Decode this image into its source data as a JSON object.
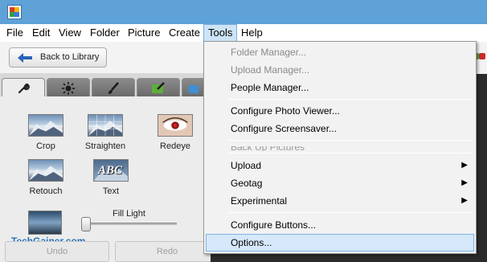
{
  "menubar": {
    "items": [
      "File",
      "Edit",
      "View",
      "Folder",
      "Picture",
      "Create",
      "Tools",
      "Help"
    ],
    "active": "Tools"
  },
  "toolbar": {
    "back_label": "Back to Library"
  },
  "edit_panel": {
    "tabs": [
      "wrench-icon",
      "brightness-icon",
      "brush-icon",
      "green-brush-icon",
      "blue-brush-icon"
    ],
    "tools": [
      {
        "label": "Crop"
      },
      {
        "label": "Straighten"
      },
      {
        "label": "Redeye"
      },
      {
        "label": "Retouch"
      },
      {
        "label": "Text",
        "thumb_text": "ABC"
      }
    ],
    "slider_label": "Fill Light",
    "undo_label": "Undo",
    "redo_label": "Redo"
  },
  "watermark": "TechGainer.com",
  "tools_menu": {
    "items": [
      {
        "label": "Folder Manager...",
        "disabled": true
      },
      {
        "label": "Upload Manager...",
        "disabled": true
      },
      {
        "label": "People Manager...",
        "disabled": false
      },
      {
        "label": "Configure Photo Viewer...",
        "disabled": false
      },
      {
        "label": "Configure Screensaver...",
        "disabled": false
      },
      {
        "label": "Back Up Pictures",
        "disabled": true
      },
      {
        "label": "Upload",
        "submenu": true
      },
      {
        "label": "Geotag",
        "submenu": true
      },
      {
        "label": "Experimental",
        "submenu": true
      },
      {
        "label": "Configure Buttons...",
        "disabled": false
      },
      {
        "label": "Options...",
        "highlighted": true
      }
    ],
    "submenu_arrow": "▶"
  },
  "colors": {
    "titlebar": "#5ea2d8",
    "menu_highlight": "#d6e8f9",
    "watermark": "#1e6fb8"
  }
}
